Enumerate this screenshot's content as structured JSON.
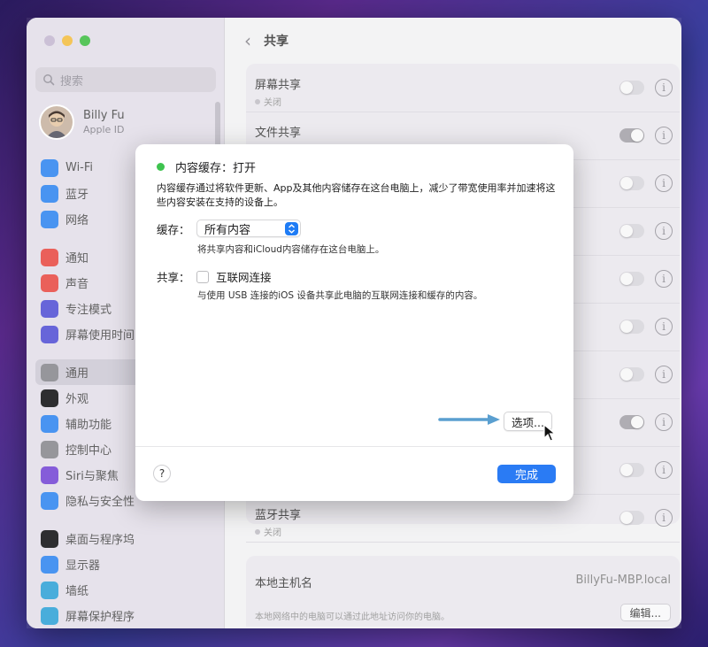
{
  "sidebar": {
    "search_placeholder": "搜索",
    "account": {
      "name": "Billy Fu",
      "subtitle": "Apple ID"
    },
    "groups": [
      [
        {
          "label": "Wi-Fi",
          "icon": "wifi-icon",
          "color": "#3a8bf0"
        },
        {
          "label": "蓝牙",
          "icon": "bluetooth-icon",
          "color": "#3a8bf0"
        },
        {
          "label": "网络",
          "icon": "globe-icon",
          "color": "#3a8bf0"
        }
      ],
      [
        {
          "label": "通知",
          "icon": "bell-icon",
          "color": "#e9534c"
        },
        {
          "label": "声音",
          "icon": "speaker-icon",
          "color": "#e9534c"
        },
        {
          "label": "专注模式",
          "icon": "moon-icon",
          "color": "#5b58d6"
        },
        {
          "label": "屏幕使用时间",
          "icon": "hourglass-icon",
          "color": "#5b58d6"
        }
      ],
      [
        {
          "label": "通用",
          "icon": "gear-icon",
          "color": "#8e8e93",
          "active": true
        },
        {
          "label": "外观",
          "icon": "appearance-icon",
          "color": "#1d1d1f"
        },
        {
          "label": "辅助功能",
          "icon": "accessibility-icon",
          "color": "#3a8bf0"
        },
        {
          "label": "控制中心",
          "icon": "control-center-icon",
          "color": "#8e8e93"
        },
        {
          "label": "Siri与聚焦",
          "icon": "siri-icon",
          "color": "#7b4fd6"
        },
        {
          "label": "隐私与安全性",
          "icon": "hand-icon",
          "color": "#3a8bf0"
        }
      ],
      [
        {
          "label": "桌面与程序坞",
          "icon": "dock-icon",
          "color": "#1d1d1f"
        },
        {
          "label": "显示器",
          "icon": "sun-icon",
          "color": "#3a8bf0"
        },
        {
          "label": "墙纸",
          "icon": "flower-icon",
          "color": "#3aa6d8"
        },
        {
          "label": "屏幕保护程序",
          "icon": "screensaver-icon",
          "color": "#3aa6d8"
        }
      ]
    ]
  },
  "header": {
    "back": "‹",
    "title": "共享"
  },
  "rows": [
    {
      "title": "屏幕共享",
      "status": "关闭",
      "on": false
    },
    {
      "title": "文件共享",
      "status": "",
      "on": true
    },
    {
      "title": "",
      "status": "",
      "on": false
    },
    {
      "title": "",
      "status": "",
      "on": false
    },
    {
      "title": "",
      "status": "",
      "on": false
    },
    {
      "title": "",
      "status": "",
      "on": false
    },
    {
      "title": "",
      "status": "",
      "on": false
    },
    {
      "title": "",
      "status": "",
      "on": true
    },
    {
      "title": "",
      "status": "",
      "on": false
    },
    {
      "title": "蓝牙共享",
      "status": "关闭",
      "on": false
    }
  ],
  "host": {
    "label": "本地主机名",
    "value": "BillyFu-MBP.local",
    "description": "本地网络中的电脑可以通过此地址访问你的电脑。",
    "edit_label": "编辑..."
  },
  "dialog": {
    "title": "内容缓存：打开",
    "description": "内容缓存通过将软件更新、App及其他内容储存在这台电脑上，减少了带宽使用率并加速将这些内容安装在支持的设备上。",
    "cache_label": "缓存：",
    "cache_value": "所有内容",
    "cache_help": "将共享内容和iCloud内容储存在这台电脑上。",
    "share_label": "共享：",
    "internet_label": "互联网连接",
    "internet_checked": false,
    "internet_help": "与使用 USB 连接的iOS 设备共享此电脑的互联网连接和缓存的内容。",
    "options_label": "选项...",
    "help_label": "?",
    "done_label": "完成"
  },
  "colors": {
    "accent": "#2a7bf4",
    "status_on": "#3ec34f"
  }
}
